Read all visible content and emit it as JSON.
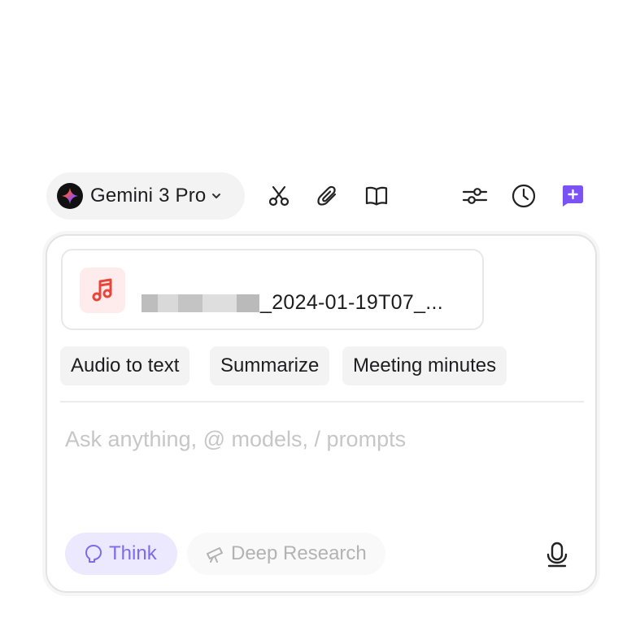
{
  "toolbar": {
    "model_name": "Gemini 3 Pro",
    "icons": [
      "model-logo-icon",
      "chevron-down-icon",
      "scissors-icon",
      "paperclip-icon",
      "book-icon",
      "sliders-icon",
      "history-icon",
      "new-chat-icon"
    ]
  },
  "attachment": {
    "file_name_visible": "_2024-01-19T07_...",
    "icon": "music-note-icon"
  },
  "quick_actions": [
    "Audio to text",
    "Summarize",
    "Meeting minutes"
  ],
  "composer": {
    "placeholder": "Ask anything, @ models, / prompts",
    "value": ""
  },
  "modes": {
    "think_label": "Think",
    "deep_research_label": "Deep Research"
  },
  "colors": {
    "accent_purple": "#7b52f5",
    "think_bg": "#ece8fd",
    "think_text": "#7b6bf0",
    "file_icon_red": "#e9453b",
    "file_icon_bg": "#fdeceb"
  }
}
